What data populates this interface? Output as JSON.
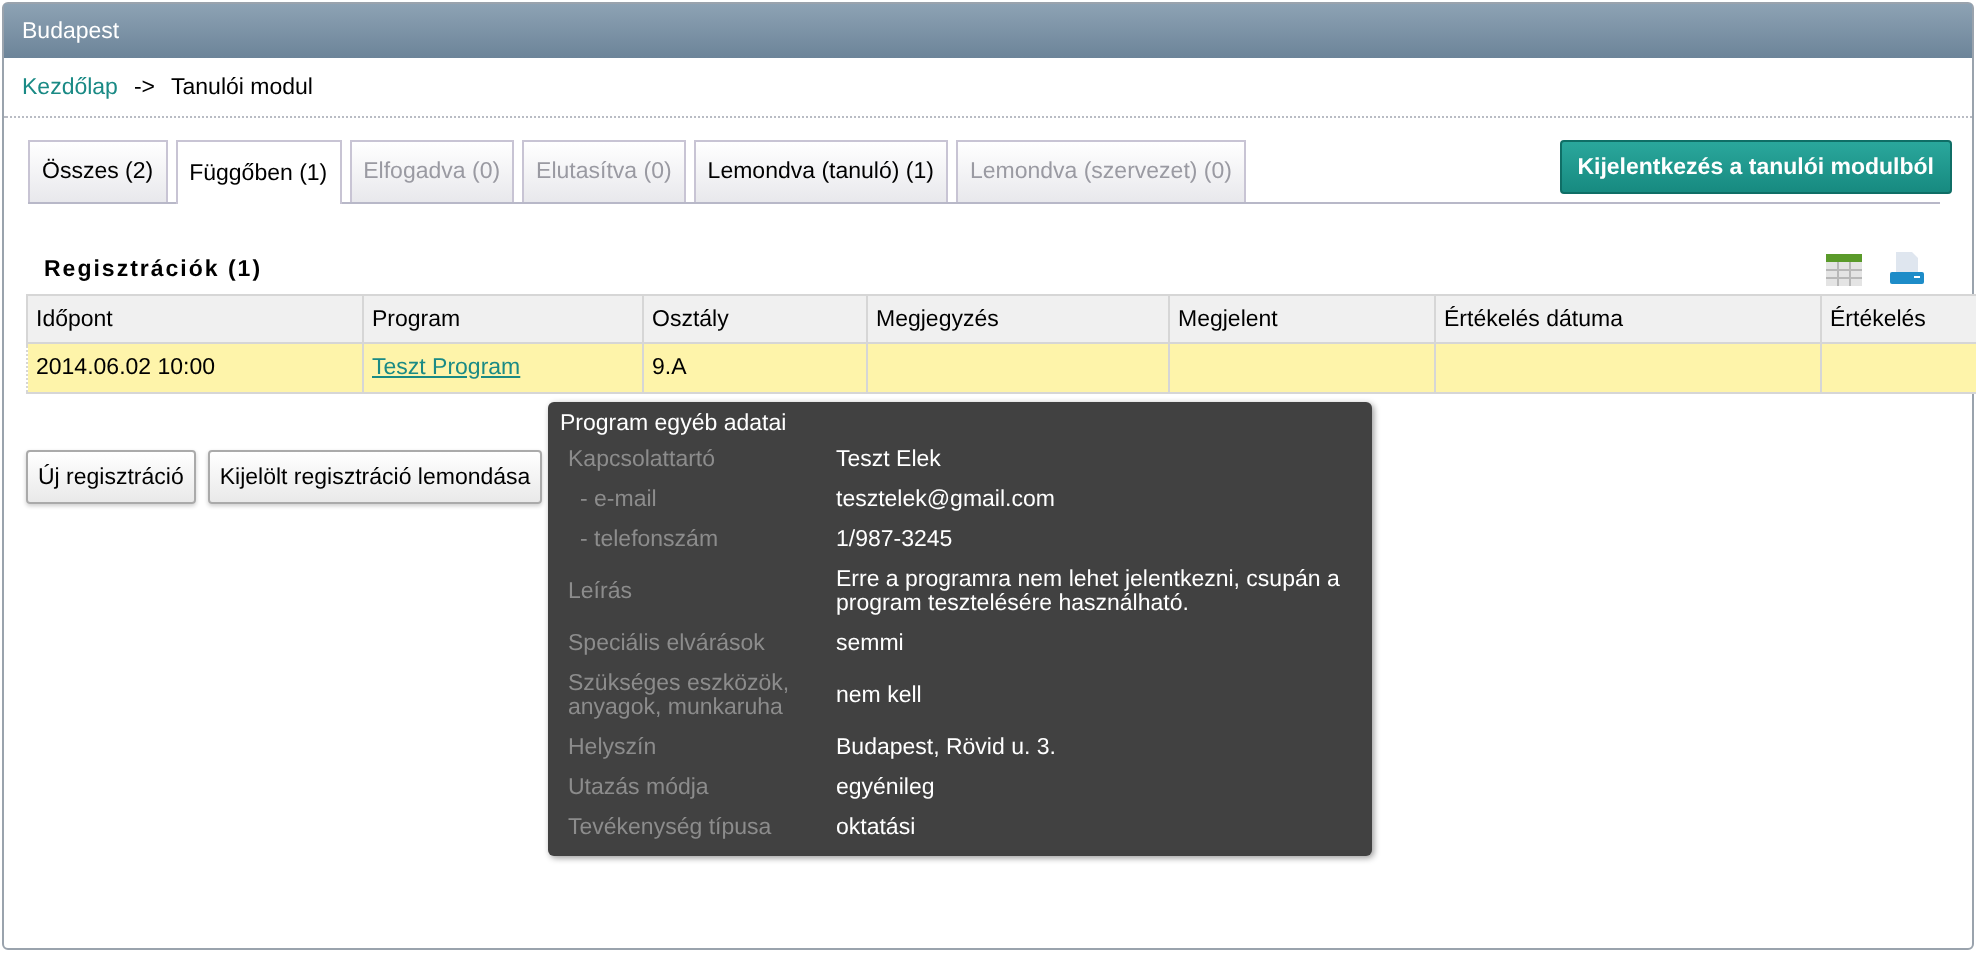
{
  "window": {
    "title": "Budapest"
  },
  "breadcrumb": {
    "home": "Kezdőlap",
    "separator": "->",
    "current": "Tanulói modul"
  },
  "tabs": [
    {
      "label": "Összes (2)",
      "selected": false,
      "disabled": false
    },
    {
      "label": "Függőben (1)",
      "selected": true,
      "disabled": false
    },
    {
      "label": "Elfogadva (0)",
      "selected": false,
      "disabled": true
    },
    {
      "label": "Elutasítva (0)",
      "selected": false,
      "disabled": true
    },
    {
      "label": "Lemondva (tanuló) (1)",
      "selected": false,
      "disabled": false
    },
    {
      "label": "Lemondva (szervezet) (0)",
      "selected": false,
      "disabled": true
    }
  ],
  "logout_button": "Kijelentkezés a tanulói modulból",
  "section_title": "Regisztrációk (1)",
  "table": {
    "columns": [
      "Időpont",
      "Program",
      "Osztály",
      "Megjegyzés",
      "Megjelent",
      "Értékelés dátuma",
      "Értékelés"
    ],
    "rows": [
      {
        "selected": true,
        "cells": [
          "2014.06.02 10:00",
          "Teszt Program",
          "9.A",
          "",
          "",
          "",
          ""
        ]
      }
    ]
  },
  "buttons": [
    "Új regisztráció",
    "Kijelölt regisztráció lemondása"
  ],
  "tooltip": {
    "title": "Program egyéb adatai",
    "rows": [
      {
        "label": "Kapcsolattartó",
        "value": "Teszt Elek",
        "sub": false
      },
      {
        "label": "- e-mail",
        "value": "tesztelek@gmail.com",
        "sub": true
      },
      {
        "label": "- telefonszám",
        "value": "1/987-3245",
        "sub": true
      },
      {
        "label": "Leírás",
        "value": "Erre a programra nem lehet jelentkezni, csupán a program tesztelésére használható.",
        "sub": false
      },
      {
        "label": "Speciális elvárások",
        "value": "semmi",
        "sub": false
      },
      {
        "label": "Szükséges eszközök, anyagok, munkaruha",
        "value": "nem kell",
        "sub": false
      },
      {
        "label": "Helyszín",
        "value": "Budapest, Rövid u. 3.",
        "sub": false
      },
      {
        "label": "Utazás módja",
        "value": "egyénileg",
        "sub": false
      },
      {
        "label": "Tevékenység típusa",
        "value": "oktatási",
        "sub": false
      }
    ]
  }
}
